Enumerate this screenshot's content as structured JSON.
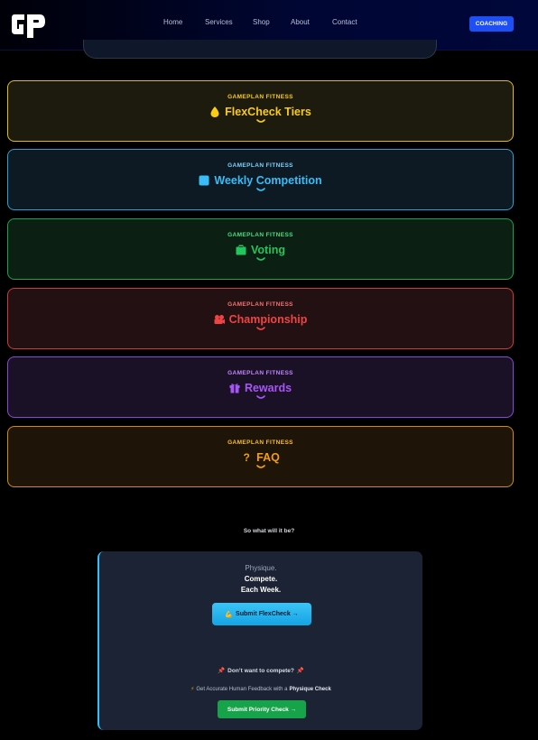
{
  "nav": {
    "logo_text": "GP",
    "links": [
      "Home",
      "Services",
      "Shop",
      "About",
      "Contact"
    ],
    "coaching_label": "COACHING",
    "accent": "#1d4ff5"
  },
  "sections": [
    {
      "label": "GAMEPLAN FITNESS",
      "title": "FlexCheck Tiers",
      "icon": "drop-icon",
      "color": "#facc15",
      "bg": "#1d1b0e",
      "border": "#e2b824"
    },
    {
      "label": "GAMEPLAN FITNESS",
      "title": "Weekly Competition",
      "icon": "calendar-icon",
      "color": "#38bdf8",
      "bg": "#0d1a23",
      "border": "#2c9fd0"
    },
    {
      "label": "GAMEPLAN FITNESS",
      "title": "Voting",
      "icon": "ballot-icon",
      "color": "#22c55e",
      "bg": "#0c1f13",
      "border": "#1f9f4b"
    },
    {
      "label": "GAMEPLAN FITNESS",
      "title": "Championship",
      "icon": "camera-icon",
      "color": "#ef4444",
      "bg": "#221012",
      "border": "#cc3a3a"
    },
    {
      "label": "GAMEPLAN FITNESS",
      "title": "Rewards",
      "icon": "gift-icon",
      "color": "#a855f7",
      "bg": "#1b1127",
      "border": "#8a48d6"
    },
    {
      "label": "GAMEPLAN FITNESS",
      "title": "FAQ",
      "icon": "question-icon",
      "color": "#f59e0b",
      "bg": "#1e1508",
      "border": "#d28a16"
    }
  ],
  "prompt": "So what will it be?",
  "cta": {
    "line1": "Physique.",
    "line2": "Compete.",
    "line3": "Each Week.",
    "submit_label": "Submit FlexCheck →",
    "no_compete": "Don’t want to compete?",
    "feedback_prefix": "Get Accurate Human Feedback with a",
    "feedback_bold": "Physique Check",
    "priority_label": "Submit Priority Check →"
  }
}
